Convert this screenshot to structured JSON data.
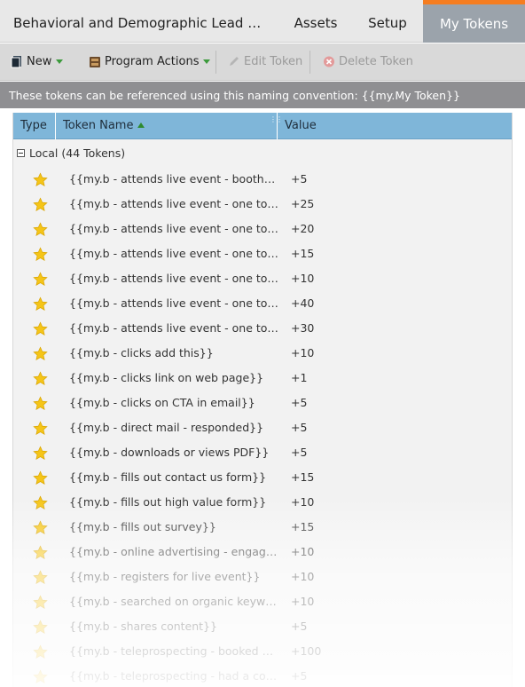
{
  "header": {
    "program_title": "Behavioral and Demographic Lead Scoring",
    "tabs": [
      {
        "label": "Assets",
        "active": false
      },
      {
        "label": "Setup",
        "active": false
      },
      {
        "label": "My Tokens",
        "active": true
      }
    ]
  },
  "toolbar": {
    "new_label": "New",
    "program_actions_label": "Program Actions",
    "edit_token_label": "Edit Token",
    "delete_token_label": "Delete Token"
  },
  "convention_note": "These tokens can be referenced using this naming convention: {{my.My Token}}",
  "grid": {
    "columns": {
      "type": "Type",
      "name": "Token Name",
      "value": "Value"
    },
    "group_label": "Local (44 Tokens)",
    "rows": [
      {
        "name": "{{my.b - attends live event - booth visit}}",
        "value": "+5"
      },
      {
        "name": "{{my.b - attends live event - one to few - ",
        "value": "+25"
      },
      {
        "name": "{{my.b - attends live event - one to few - ",
        "value": "+20"
      },
      {
        "name": "{{my.b - attends live event - one to many",
        "value": "+15"
      },
      {
        "name": "{{my.b - attends live event - one to many",
        "value": "+10"
      },
      {
        "name": "{{my.b - attends live event - one to one - ",
        "value": "+40"
      },
      {
        "name": "{{my.b - attends live event - one to one - ",
        "value": "+30"
      },
      {
        "name": "{{my.b - clicks add this}}",
        "value": "+10"
      },
      {
        "name": "{{my.b - clicks link on web page}}",
        "value": "+1"
      },
      {
        "name": "{{my.b - clicks on CTA in email}}",
        "value": "+5"
      },
      {
        "name": "{{my.b - direct mail - responded}}",
        "value": "+5"
      },
      {
        "name": "{{my.b - downloads or views PDF}}",
        "value": "+5"
      },
      {
        "name": "{{my.b - fills out contact us form}}",
        "value": "+15"
      },
      {
        "name": "{{my.b - fills out high value form}}",
        "value": "+10"
      },
      {
        "name": "{{my.b - fills out survey}}",
        "value": "+15"
      },
      {
        "name": "{{my.b - online advertising - engaged-do",
        "value": "+10"
      },
      {
        "name": "{{my.b - registers for live event}}",
        "value": "+10"
      },
      {
        "name": "{{my.b - searched on organic keyword}}",
        "value": "+10"
      },
      {
        "name": "{{my.b - shares content}}",
        "value": "+5"
      },
      {
        "name": "{{my.b - teleprospecting - booked a mee",
        "value": "+100"
      },
      {
        "name": "{{my.b - teleprospecting - had a convers",
        "value": "+5"
      }
    ]
  },
  "colors": {
    "active_tab_accent": "#f57d20",
    "grid_header": "#7fb6d9",
    "star": "#f5c518"
  }
}
